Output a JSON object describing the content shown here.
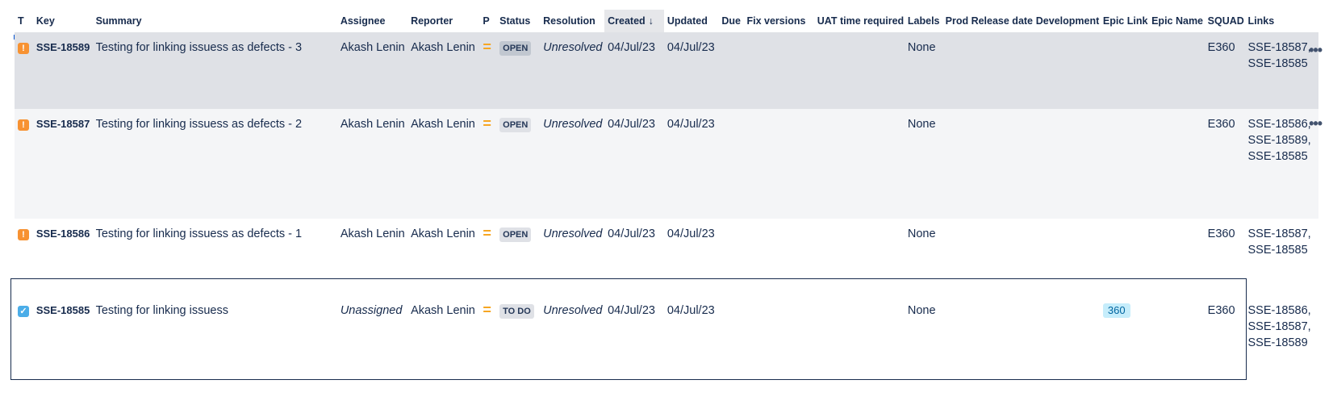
{
  "columns": [
    {
      "id": "type",
      "label": "T"
    },
    {
      "id": "key",
      "label": "Key"
    },
    {
      "id": "summary",
      "label": "Summary"
    },
    {
      "id": "assignee",
      "label": "Assignee"
    },
    {
      "id": "reporter",
      "label": "Reporter"
    },
    {
      "id": "priority",
      "label": "P"
    },
    {
      "id": "status",
      "label": "Status"
    },
    {
      "id": "resolution",
      "label": "Resolution"
    },
    {
      "id": "created",
      "label": "Created",
      "sort_arrow": "↓"
    },
    {
      "id": "updated",
      "label": "Updated"
    },
    {
      "id": "due",
      "label": "Due"
    },
    {
      "id": "fix_versions",
      "label": "Fix versions"
    },
    {
      "id": "uat",
      "label": "UAT time required"
    },
    {
      "id": "labels",
      "label": "Labels"
    },
    {
      "id": "prod_release",
      "label": "Prod Release date"
    },
    {
      "id": "development",
      "label": "Development"
    },
    {
      "id": "epic_link",
      "label": "Epic Link"
    },
    {
      "id": "epic_name",
      "label": "Epic Name"
    },
    {
      "id": "squad",
      "label": "SQUAD"
    },
    {
      "id": "links",
      "label": "Links"
    }
  ],
  "colors": {
    "bug_icon": "#f79232",
    "task_icon": "#4bade8",
    "priority_medium": "#f6a623",
    "selected_row_bg": "#dfe1e6",
    "hover_row_bg": "#f4f5f7"
  },
  "priority_glyph": "=",
  "more_glyph": "•••",
  "rows": [
    {
      "type_icon": "bug-icon",
      "type_glyph": "!",
      "key": "SSE-18589",
      "summary": "Testing for linking issuess as defects - 3",
      "assignee": "Akash Lenin",
      "reporter": "Akash Lenin",
      "status": "OPEN",
      "resolution": "Unresolved",
      "created": "04/Jul/23",
      "updated": "04/Jul/23",
      "labels": "None",
      "epic_link": "",
      "squad": "E360",
      "links": "SSE-18587, SSE-18585"
    },
    {
      "type_icon": "bug-icon",
      "type_glyph": "!",
      "key": "SSE-18587",
      "summary": "Testing for linking issuess as defects - 2",
      "assignee": "Akash Lenin",
      "reporter": "Akash Lenin",
      "status": "OPEN",
      "resolution": "Unresolved",
      "created": "04/Jul/23",
      "updated": "04/Jul/23",
      "labels": "None",
      "epic_link": "",
      "squad": "E360",
      "links": "SSE-18586, SSE-18589, SSE-18585"
    },
    {
      "type_icon": "bug-icon",
      "type_glyph": "!",
      "key": "SSE-18586",
      "summary": "Testing for linking issuess as defects - 1",
      "assignee": "Akash Lenin",
      "reporter": "Akash Lenin",
      "status": "OPEN",
      "resolution": "Unresolved",
      "created": "04/Jul/23",
      "updated": "04/Jul/23",
      "labels": "None",
      "epic_link": "",
      "squad": "E360",
      "links": "SSE-18587, SSE-18585"
    },
    {
      "type_icon": "task-icon",
      "type_glyph": "✓",
      "key": "SSE-18585",
      "summary": "Testing for linking issuess",
      "assignee": "Unassigned",
      "reporter": "Akash Lenin",
      "status": "TO DO",
      "resolution": "Unresolved",
      "created": "04/Jul/23",
      "updated": "04/Jul/23",
      "labels": "None",
      "epic_link": "360",
      "squad": "E360",
      "links": "SSE-18586, SSE-18587, SSE-18589"
    }
  ]
}
